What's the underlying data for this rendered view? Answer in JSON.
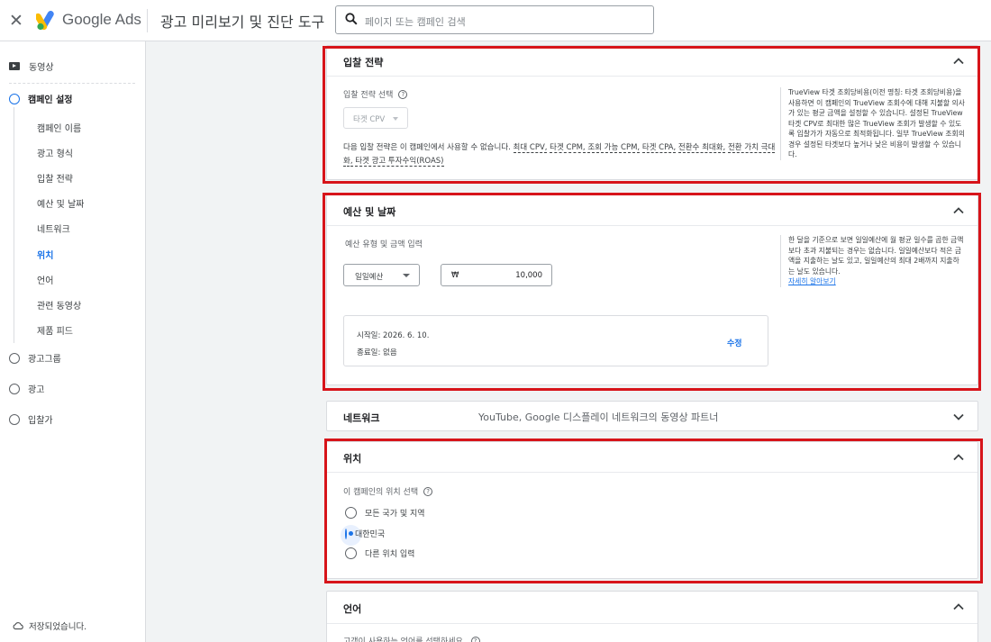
{
  "header": {
    "close_icon": "close-icon",
    "brand": "Google Ads",
    "tool_title": "광고 미리보기 및 진단 도구",
    "search_placeholder": "페이지 또는 캠페인 검색",
    "colors": {
      "blue": "#4285f4",
      "yellow": "#fbbc04",
      "green": "#34a853"
    }
  },
  "sidebar": {
    "video": "동영상",
    "campaign_settings": "캠페인 설정",
    "sub_items": [
      "캠페인 이름",
      "광고 형식",
      "입찰 전략",
      "예산 및 날짜",
      "네트워크",
      "위치",
      "언어",
      "관련 동영상",
      "제품 피드"
    ],
    "current_sub": "위치",
    "steps": [
      "광고그룹",
      "광고",
      "입찰가"
    ],
    "saved": "저장되었습니다."
  },
  "bidding": {
    "title": "입찰 전략",
    "select_label": "입찰 전략 선택",
    "dropdown_value": "타겟 CPV",
    "note_prefix": "다음 입찰 전략은 이 캠페인에서 사용할 수 없습니다.",
    "unavailable": [
      "최대 CPV,",
      "타겟 CPM,",
      "조회 가능 CPM,",
      "타겟 CPA,",
      "전환수 최대화,",
      "전환 가치 극대화,",
      "타겟 광고 투자수익(ROAS)"
    ],
    "aside": "TrueView 타겟 조회당비용(이전 명칭: 타겟 조회당비용)을 사용하면 이 캠페인의 TrueView 조회수에 대해 지불할 의사가 있는 평균 금액을 설정할 수 있습니다. 설정된 TrueView 타겟 CPV로 최대한 많은 TrueView 조회가 발생할 수 있도록 입찰가가 자동으로 최적화됩니다. 일부 TrueView 조회의 경우 설정된 타겟보다 높거나 낮은 비용이 발생할 수 있습니다."
  },
  "budget": {
    "title": "예산 및 날짜",
    "type_label": "예산 유형 및 금액 입력",
    "type_value": "일일예산",
    "currency": "₩",
    "amount": "10,000",
    "start": "시작일: 2026. 6. 10.",
    "end": "종료일: 없음",
    "edit": "수정",
    "aside": "한 달을 기준으로 보면 일일예산에 월 평균 일수를 곱한 금액보다 초과 지불되는 경우는 없습니다. 일일예산보다 적은 금액을 지출하는 날도 있고, 일일예산의 최대 2배까지 지출하는 날도 있습니다.",
    "learn_more": "자세히 알아보기"
  },
  "network": {
    "title": "네트워크",
    "desc": "YouTube, Google 디스플레이 네트워크의 동영상 파트너"
  },
  "location": {
    "title": "위치",
    "select_label": "이 캠페인의 위치 선택",
    "options": [
      "모든 국가 및 지역",
      "대한민국",
      "다른 위치 입력"
    ],
    "selected_index": 1
  },
  "language": {
    "title": "언어",
    "select_label": "고객이 사용하는 언어를 선택하세요."
  },
  "highlight_color": "#d7141a"
}
